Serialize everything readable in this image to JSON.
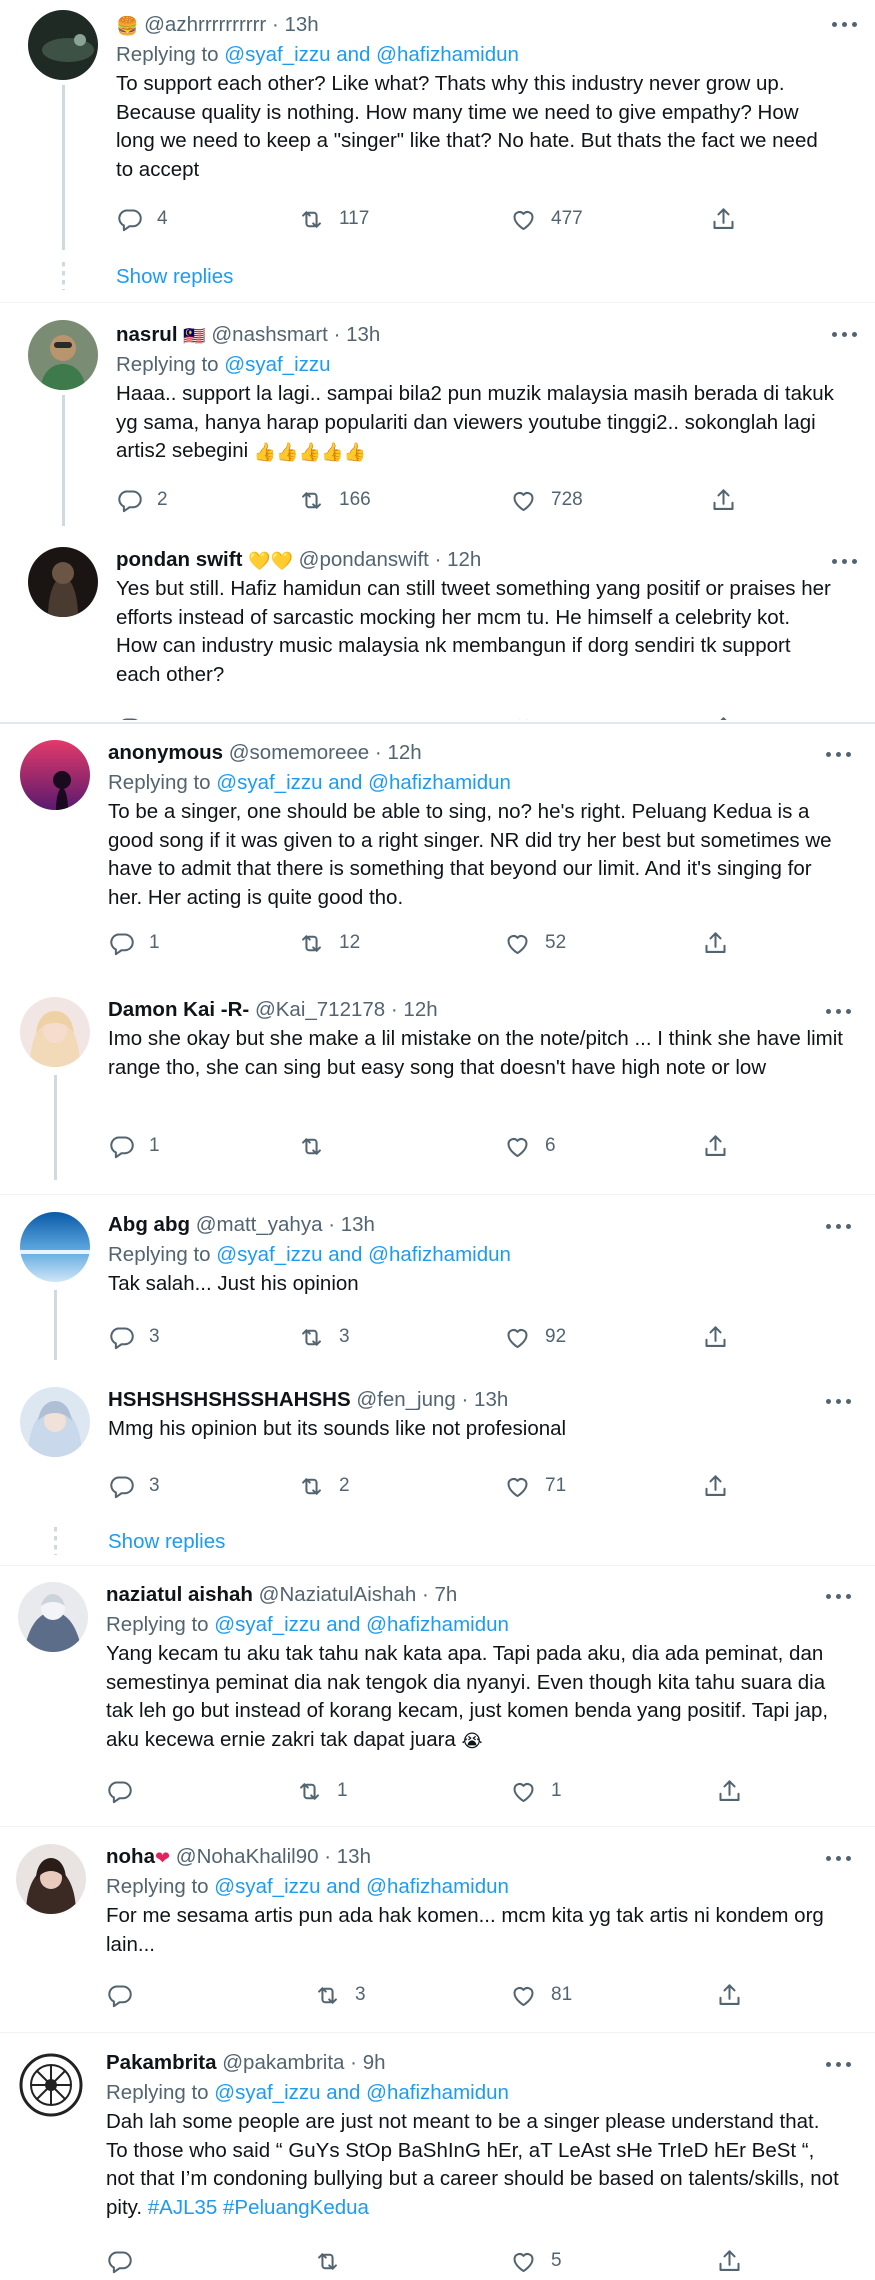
{
  "labels": {
    "replying_to": "Replying to",
    "and": "and",
    "dot": "·",
    "show_replies": "Show replies"
  },
  "colors": {
    "accent": "#1d9bf0",
    "text": "#0f1419",
    "muted": "#536471",
    "line": "#cfd9de"
  },
  "tweets": [
    {
      "name": "",
      "name_emoji": "🍔",
      "handle": "@azhrrrrrrrrrr",
      "time": "13h",
      "reply_to": [
        "@syaf_izzu",
        "@hafizhamidun"
      ],
      "text": "To support each other? Like what? Thats why this industry never grow up. Because quality is nothing. How many time we need to give empathy? How long we need to keep a \"singer\" like that? No hate. But thats the fact we need to accept",
      "replies": "4",
      "retweets": "117",
      "likes": "477"
    },
    {
      "name": "nasrul",
      "name_emoji": "🇲🇾",
      "handle": "@nashsmart",
      "time": "13h",
      "reply_to": [
        "@syaf_izzu"
      ],
      "text": "Haaa.. support la lagi.. sampai bila2 pun muzik malaysia masih berada di takuk yg sama, hanya harap populariti dan viewers youtube tinggi2.. sokonglah lagi artis2 sebegini",
      "text_emoji": "👍👍👍👍👍",
      "replies": "2",
      "retweets": "166",
      "likes": "728"
    },
    {
      "name": "pondan swift",
      "name_emoji": "💛💛",
      "handle": "@pondanswift",
      "time": "12h",
      "text": "Yes but still. Hafiz hamidun can still tweet something yang positif or praises her efforts instead of sarcastic mocking her mcm tu. He himself a celebrity kot. How can industry music malaysia nk membangun if dorg sendiri tk support each other?"
    },
    {
      "name": "anonymous",
      "handle": "@somemoreee",
      "time": "12h",
      "reply_to": [
        "@syaf_izzu",
        "@hafizhamidun"
      ],
      "text": "To be a singer, one should be able to sing, no? he's right. Peluang Kedua is a good song if it was given to a right singer. NR did try her best but sometimes we have to admit that there is something that beyond our limit. And it's singing for her. Her acting is quite good tho.",
      "replies": "1",
      "retweets": "12",
      "likes": "52"
    },
    {
      "name": "Damon Kai -R-",
      "handle": "@Kai_712178",
      "time": "12h",
      "text": "Imo she okay but she make a lil mistake on the note/pitch ... I think she have limit range tho, she can sing but easy song that doesn't have high note or low",
      "replies": "1",
      "retweets": "",
      "likes": "6"
    },
    {
      "name": "Abg abg",
      "handle": "@matt_yahya",
      "time": "13h",
      "reply_to": [
        "@syaf_izzu",
        "@hafizhamidun"
      ],
      "text": "Tak salah... Just his opinion",
      "replies": "3",
      "retweets": "3",
      "likes": "92"
    },
    {
      "name": "HSHSHSHSHSSHAHSHS",
      "handle": "@fen_jung",
      "time": "13h",
      "text": "Mmg his opinion but its sounds like not profesional",
      "replies": "3",
      "retweets": "2",
      "likes": "71"
    },
    {
      "name": "naziatul aishah",
      "handle": "@NaziatulAishah",
      "time": "7h",
      "reply_to": [
        "@syaf_izzu",
        "@hafizhamidun"
      ],
      "text": "Yang kecam tu aku tak tahu nak kata apa. Tapi pada aku, dia ada peminat, dan semestinya peminat dia nak tengok dia nyanyi. Even though kita tahu suara dia tak leh go but instead of korang kecam, just komen benda yang positif. Tapi jap, aku kecewa ernie zakri tak dapat juara",
      "text_emoji": "😭",
      "replies": "",
      "retweets": "1",
      "likes": "1"
    },
    {
      "name": "noha",
      "name_emoji": "❤",
      "handle": "@NohaKhalil90",
      "time": "13h",
      "reply_to": [
        "@syaf_izzu",
        "@hafizhamidun"
      ],
      "text": "For me sesama artis pun ada hak komen... mcm kita yg tak artis ni kondem org lain...",
      "replies": "",
      "retweets": "3",
      "likes": "81"
    },
    {
      "name": "Pakambrita",
      "handle": "@pakambrita",
      "time": "9h",
      "reply_to": [
        "@syaf_izzu",
        "@hafizhamidun"
      ],
      "text": "Dah lah some people are just not meant to be a singer please understand that. To those who said “ GuYs StOp BaShInG hEr, aT LeAst sHe TrIeD hEr BeSt “, not that I’m condoning bullying but a career should be based on talents/skills, not pity.",
      "hashtags": [
        "#AJL35",
        "#PeluangKedua"
      ],
      "replies": "",
      "retweets": "",
      "likes": "5"
    }
  ]
}
